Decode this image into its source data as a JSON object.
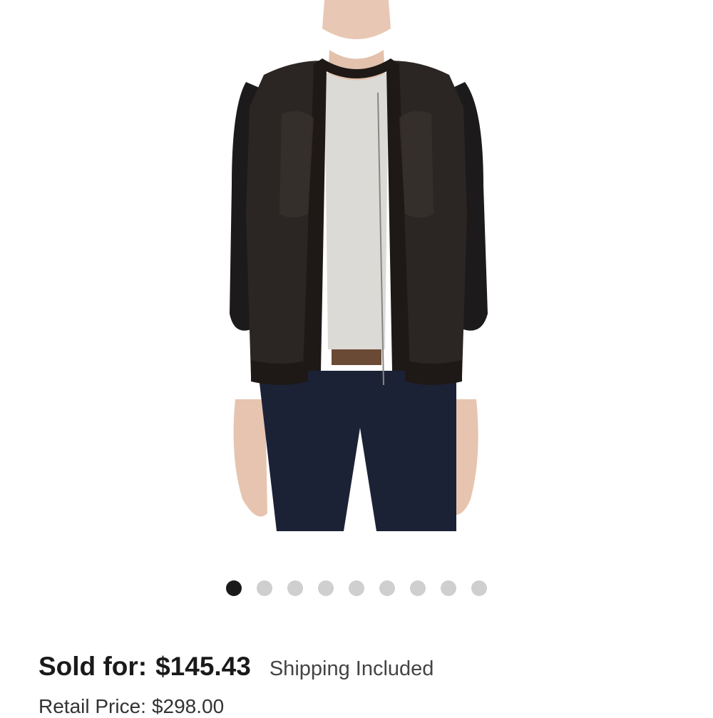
{
  "product": {
    "image_alt": "Black leather front jacket with fur trim",
    "colors": {
      "jacket_knit": "#1c1a1a",
      "jacket_leather": "#2b2624",
      "fur_trim": "#1e1917",
      "shirt": "#dcdad6",
      "jeans": "#1c2236",
      "skin": "#e8c8b4"
    }
  },
  "carousel": {
    "total": 9,
    "active_index": 0,
    "colors": {
      "active": "#1a1a1a",
      "inactive": "#cfcfcf"
    }
  },
  "pricing": {
    "sold_label": "Sold for:",
    "sold_price": "$145.43",
    "shipping_note": "Shipping Included",
    "retail_label": "Retail Price:",
    "retail_price": "$298.00"
  }
}
